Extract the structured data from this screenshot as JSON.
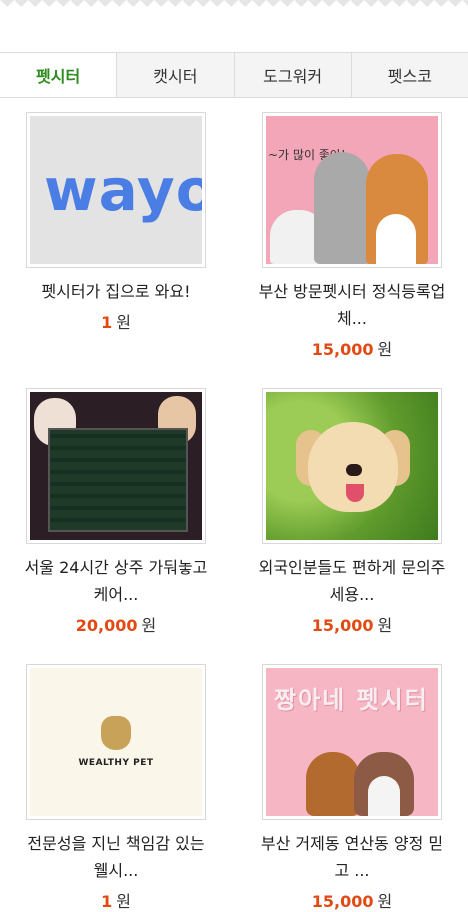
{
  "tabs": [
    {
      "label": "펫시터"
    },
    {
      "label": "캣시터"
    },
    {
      "label": "도그워커"
    },
    {
      "label": "펫스코"
    }
  ],
  "listings": [
    {
      "image_text": "wayo",
      "title": "펫시터가 집으로 와요!",
      "price": "1",
      "unit": "원"
    },
    {
      "image_text": "~가 많이 좋아!",
      "title": "부산 방문펫시터 정식등록업체...",
      "price": "15,000",
      "unit": "원"
    },
    {
      "image_text": "",
      "title": "서울 24시간 상주 가둬놓고 케어...",
      "price": "20,000",
      "unit": "원"
    },
    {
      "image_text": "",
      "title": "외국인분들도 편하게 문의주세용...",
      "price": "15,000",
      "unit": "원"
    },
    {
      "image_text": "WEALTHY PET",
      "title": "전문성을 지닌 책임감 있는 웰시...",
      "price": "1",
      "unit": "원"
    },
    {
      "image_text": "짱아네 펫시터",
      "title": "부산 거제동 연산동 양정 믿고 ...",
      "price": "15,000",
      "unit": "원"
    }
  ],
  "colors": {
    "active_tab": "#2e8b1e",
    "price": "#e24a14"
  }
}
